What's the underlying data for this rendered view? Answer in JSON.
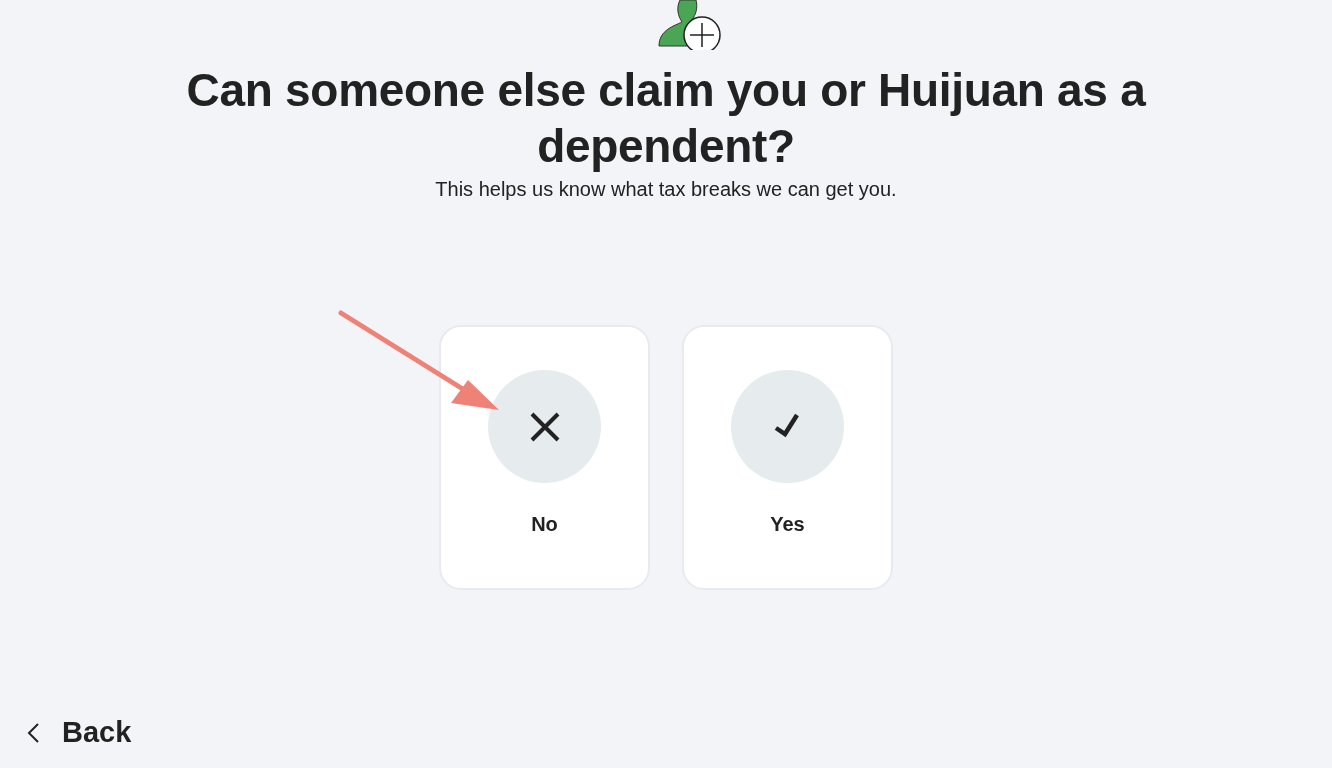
{
  "title": "Can someone else claim you or Huijuan as a dependent?",
  "subtitle": "This helps us know what tax breaks we can get you.",
  "options": [
    {
      "kind": "cross",
      "label": "No"
    },
    {
      "kind": "check",
      "label": "Yes"
    }
  ],
  "back": {
    "label": "Back"
  }
}
